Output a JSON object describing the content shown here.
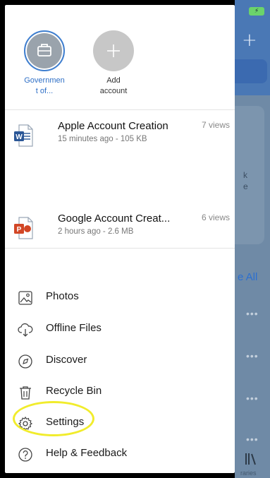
{
  "accounts": [
    {
      "label": "Governmen\nt of...",
      "icon": "briefcase-icon"
    },
    {
      "label": "Add\naccount",
      "icon": "plus-icon"
    }
  ],
  "recent_files": [
    {
      "name": "Apple Account Creation",
      "meta": "15 minutes ago - 105 KB",
      "views": "7 views",
      "type": "word",
      "badge": "W"
    },
    {
      "name": "Google Account Creat...",
      "meta": "2 hours ago - 2.6 MB",
      "views": "6 views",
      "type": "powerpoint",
      "badge": "P"
    }
  ],
  "menu": [
    {
      "label": "Photos",
      "icon": "photos-icon"
    },
    {
      "label": "Offline Files",
      "icon": "cloud-download-icon"
    },
    {
      "label": "Discover",
      "icon": "compass-icon"
    },
    {
      "label": "Recycle Bin",
      "icon": "trash-icon"
    },
    {
      "label": "Settings",
      "icon": "gear-icon"
    },
    {
      "label": "Help & Feedback",
      "icon": "help-icon"
    }
  ],
  "background": {
    "see_all": "e All",
    "card_text": "k\ne",
    "libraries_label": "raries",
    "dots": "•••"
  },
  "colors": {
    "accent_blue": "#2e6fc6",
    "word_blue": "#2b5797",
    "powerpoint_red": "#d24726",
    "highlight_yellow": "#f1ec2c"
  }
}
